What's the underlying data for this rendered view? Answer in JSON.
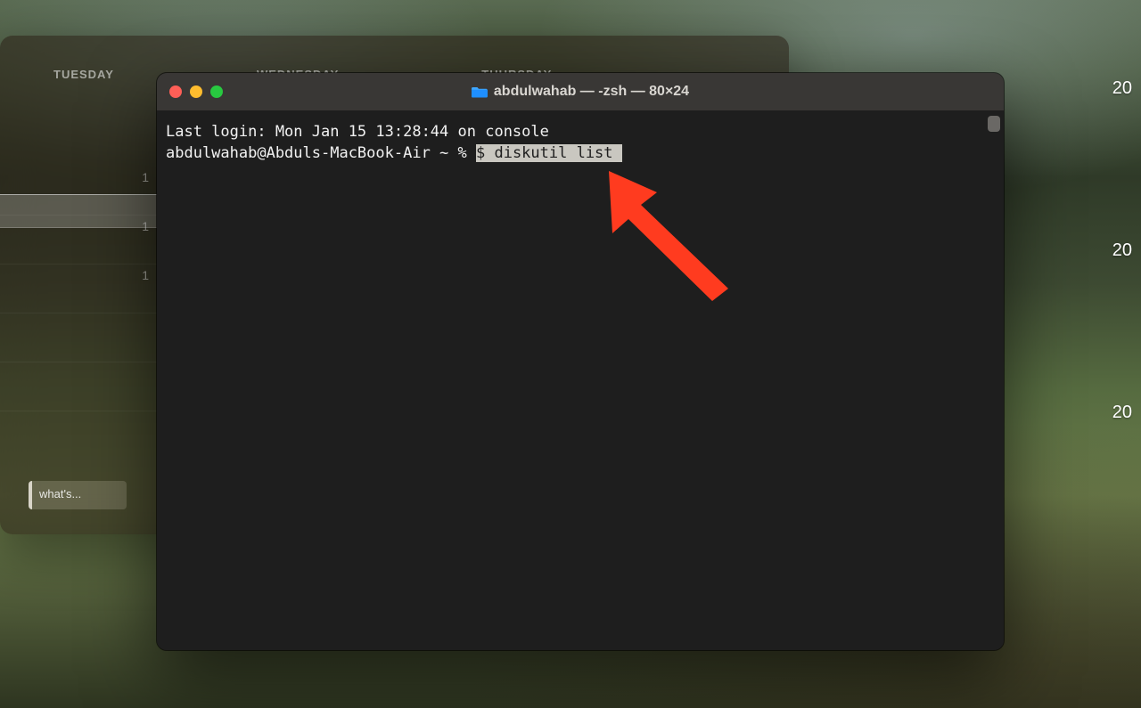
{
  "calendar": {
    "days": [
      "TUESDAY",
      "WEDNESDAY",
      "THURSDAY"
    ],
    "hours": [
      "1",
      "1",
      "1"
    ],
    "event_label": "what's..."
  },
  "desktop_badges": [
    "20",
    "20",
    "20"
  ],
  "terminal": {
    "title": "abdulwahab — -zsh — 80×24",
    "last_login": "Last login: Mon Jan 15 13:28:44 on console",
    "prompt": "abdulwahab@Abduls-MacBook-Air ~ % ",
    "command_selected": "$ diskutil list"
  }
}
